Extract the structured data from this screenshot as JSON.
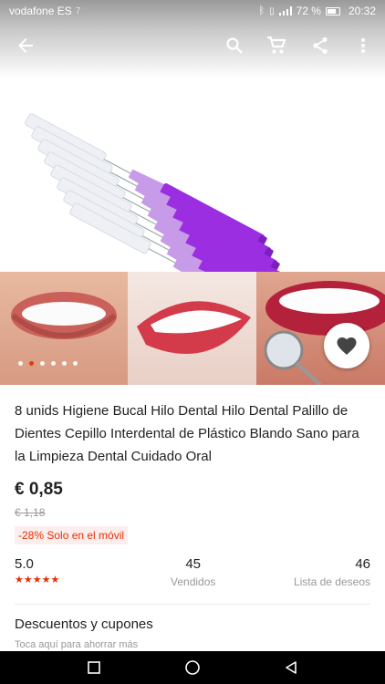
{
  "status_bar": {
    "carrier": "vodafone ES",
    "carrier_extra": "7",
    "battery": "72 %",
    "time": "20:32"
  },
  "toolbar": {
    "back_icon": "back-arrow-icon",
    "search_icon": "search-icon",
    "cart_icon": "cart-icon",
    "share_icon": "share-icon",
    "more_icon": "more-vertical-icon"
  },
  "gallery": {
    "total_dots": 6,
    "active_dot": 2
  },
  "product": {
    "title": "8 unids Higiene Bucal Hilo Dental Hilo Dental Palillo de Dientes Cepillo Interdental de Plástico Blando Sano para la Limpieza Dental Cuidado Oral",
    "price": "€ 0,85",
    "old_price": "€ 1,18",
    "discount_badge": "-28% Solo en el móvil"
  },
  "stats": {
    "rating": "5.0",
    "rating_stars": "★★★★★",
    "sold_count": "45",
    "sold_label": "Vendidos",
    "wishlist_count": "46",
    "wishlist_label": "Lista de deseos"
  },
  "coupons": {
    "title": "Descuentos y cupones",
    "subtitle": "Toca aquí para ahorrar más"
  },
  "colors": {
    "accent": "#e62e04",
    "brush_purple": "#9b2ee0"
  }
}
